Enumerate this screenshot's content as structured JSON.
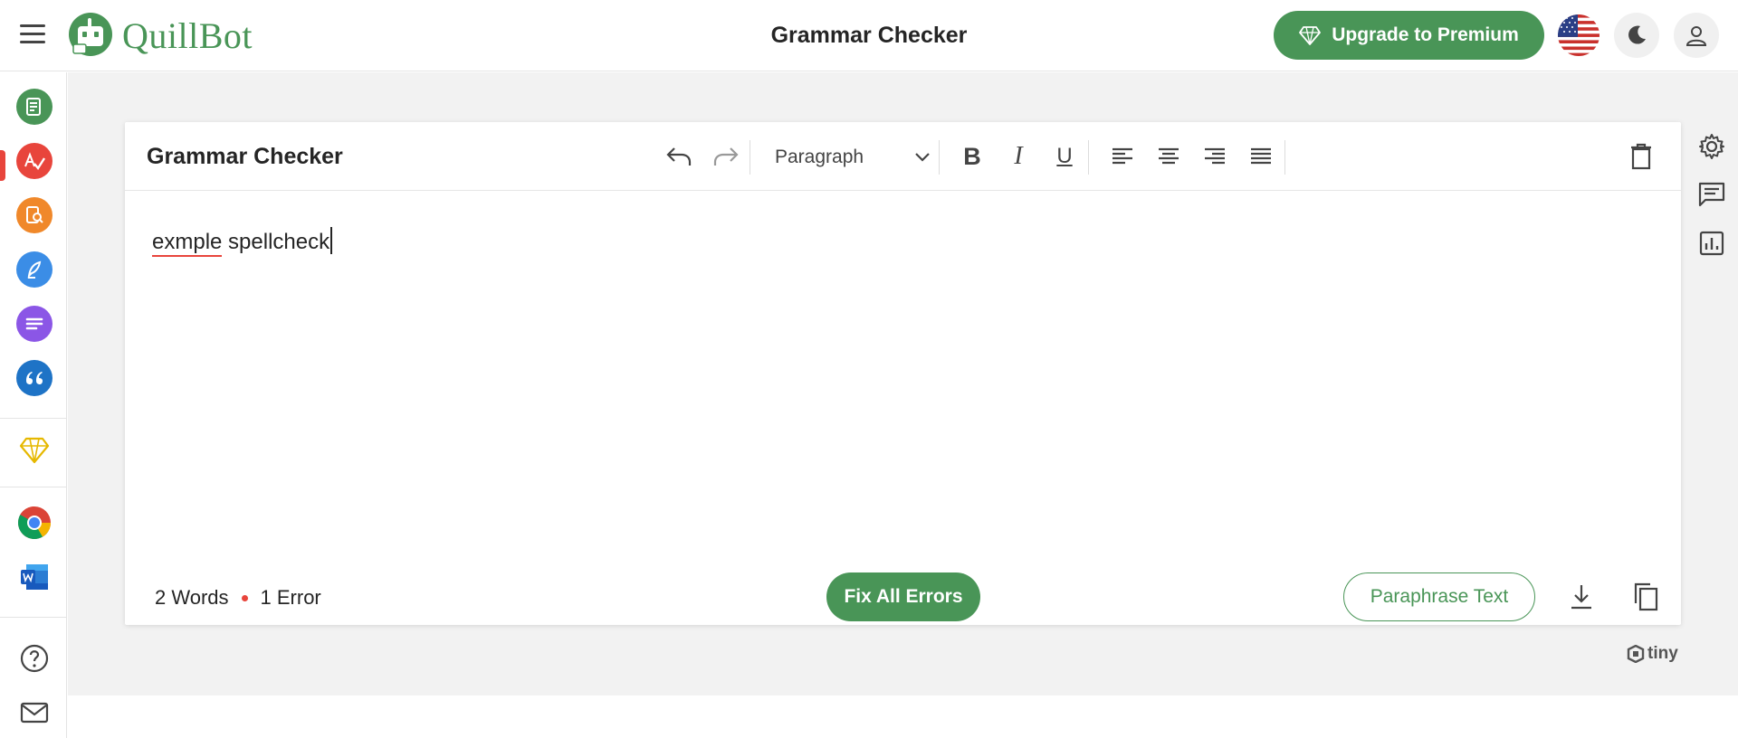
{
  "header": {
    "brand": "QuillBot",
    "title": "Grammar Checker",
    "upgrade_label": "Upgrade to Premium"
  },
  "sidebar": {
    "items": [
      {
        "icon": "paraphraser-icon",
        "color": "#499557"
      },
      {
        "icon": "grammar-checker-icon",
        "color": "#e8453c",
        "active": true
      },
      {
        "icon": "plagiarism-checker-icon",
        "color": "#f0882a"
      },
      {
        "icon": "co-writer-icon",
        "color": "#3b8de6"
      },
      {
        "icon": "summarizer-icon",
        "color": "#8b56e6"
      },
      {
        "icon": "citation-generator-icon",
        "color": "#1e73c6"
      },
      {
        "icon": "premium-diamond-icon",
        "color": "#e6b800"
      },
      {
        "icon": "chrome-extension-icon"
      },
      {
        "icon": "word-addin-icon"
      },
      {
        "icon": "help-icon"
      },
      {
        "icon": "mail-icon"
      }
    ]
  },
  "editor_card": {
    "title": "Grammar Checker",
    "paragraph_select": "Paragraph",
    "bold_label": "B",
    "italic_label": "I",
    "underline_label": "U",
    "text_misspelled": "exmple",
    "text_rest": " spellcheck"
  },
  "footer": {
    "words": "2 Words",
    "errors": "1 Error",
    "fix_label": "Fix All Errors",
    "paraphrase_label": "Paraphrase Text"
  },
  "branding": {
    "tiny": "tiny"
  },
  "colors": {
    "brand_green": "#499557",
    "error_red": "#e8453c",
    "background": "#f2f2f2"
  }
}
